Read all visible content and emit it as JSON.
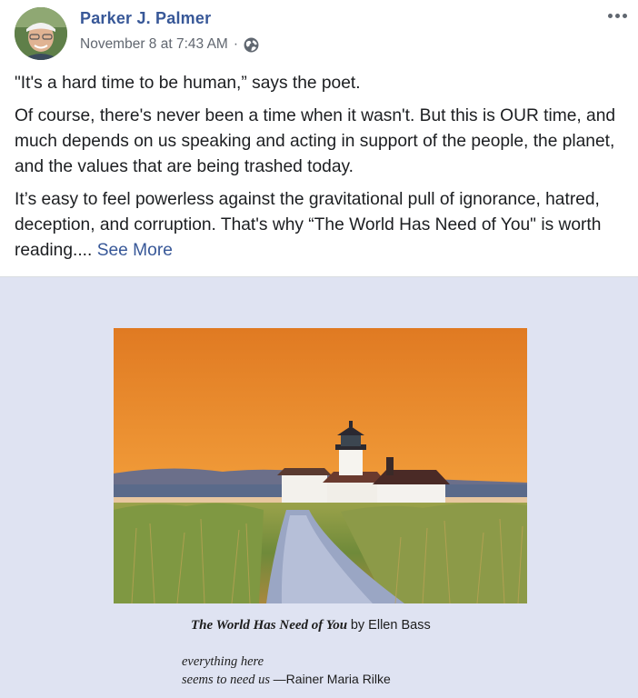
{
  "post": {
    "author": "Parker J. Palmer",
    "timestamp": "November 8 at 7:43 AM",
    "separator": "·",
    "privacy_icon": "globe-icon",
    "menu_icon": "more-options-icon",
    "paragraphs": [
      "\"It's a hard time to be human,” says the poet.",
      "Of course, there's never been a time when it wasn't. But this is OUR time, and much depends on us speaking and acting in support of the people, the planet, and the values that are being trashed today.",
      "It’s easy to feel powerless against the gravitational pull of ignorance, hatred, deception, and corruption. That's why “The World Has Need of You\" is worth reading...."
    ],
    "see_more": "See More"
  },
  "media": {
    "background": "#dfe3f2",
    "caption_title": "The World Has Need of You",
    "caption_by": "by Ellen Bass",
    "epigraph_line1": "everything here",
    "epigraph_line2": "seems to need us",
    "epigraph_attr": "—Rainer Maria Rilke"
  },
  "colors": {
    "link": "#385898",
    "text": "#1c1e21",
    "meta": "#616770"
  }
}
